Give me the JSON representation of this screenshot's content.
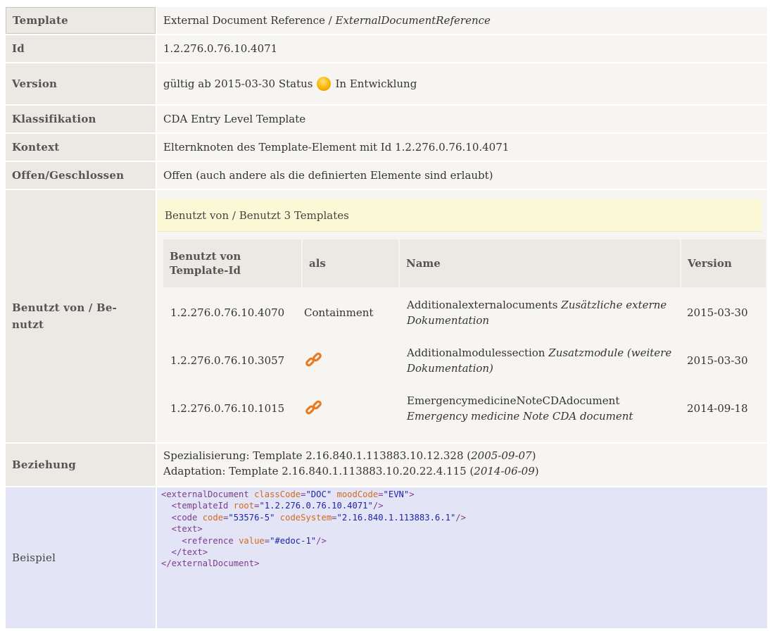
{
  "rows": {
    "template": {
      "label": "Template",
      "value_plain": "External Document Reference / ",
      "value_italic": "ExternalDocumentReference"
    },
    "id": {
      "label": "Id",
      "value": "1.2.276.0.76.10.4071"
    },
    "version": {
      "label": "Version",
      "prefix": "gültig ab 2015-03-30 Status",
      "status": "In Entwicklung"
    },
    "klassifikation": {
      "label": "Klassifikation",
      "value": "CDA Entry Level Template"
    },
    "kontext": {
      "label": "Kontext",
      "value": "Elternknoten des Template-Element mit Id 1.2.276.0.76.10.4071"
    },
    "offen": {
      "label": "Offen/Geschlossen",
      "value": "Offen (auch andere als die definierten Elemente sind erlaubt)"
    },
    "benutzt": {
      "label": "Benutzt von / Be-nutzt",
      "header": "Benutzt von / Benutzt 3 Templates",
      "columns": [
        "Benutzt von Template-Id",
        "als",
        "Name",
        "Version"
      ],
      "items": [
        {
          "id": "1.2.276.0.76.10.4070",
          "als": "Containment",
          "name": "Additionalexternalocuments",
          "name_italic": "Zusätzliche externe Dokumentation",
          "version": "2015-03-30",
          "icon": ""
        },
        {
          "id": "1.2.276.0.76.10.3057",
          "als": "",
          "name": "Additionalmodulessection",
          "name_italic": "Zusatzmodule (weitere Dokumentation)",
          "version": "2015-03-30",
          "icon": "link-icon"
        },
        {
          "id": "1.2.276.0.76.10.1015",
          "als": "",
          "name": "EmergencymedicineNoteCDAdocument",
          "name_italic": "Emergency medicine Note CDA document",
          "version": "2014-09-18",
          "icon": "link-icon"
        }
      ]
    },
    "beziehung": {
      "label": "Beziehung",
      "line1_plain": "Spezialisierung: Template 2.16.840.1.113883.10.12.328 (",
      "line1_date": "2005-09-07",
      "line1_end": ")",
      "line2_plain": "Adaptation: Template 2.16.840.1.113883.10.20.22.4.115 (",
      "line2_date": "2014-06-09",
      "line2_end": ")"
    },
    "beispiel": {
      "label": "Beispiel"
    }
  },
  "colors": {
    "label_bg": "#ece9e4",
    "value_bg": "#f7f5f2",
    "usedby_bg": "#fbf8d6",
    "code_bg": "#e3e5f7",
    "status_dot": "#f6b500",
    "link_icon": "#e87a22"
  }
}
